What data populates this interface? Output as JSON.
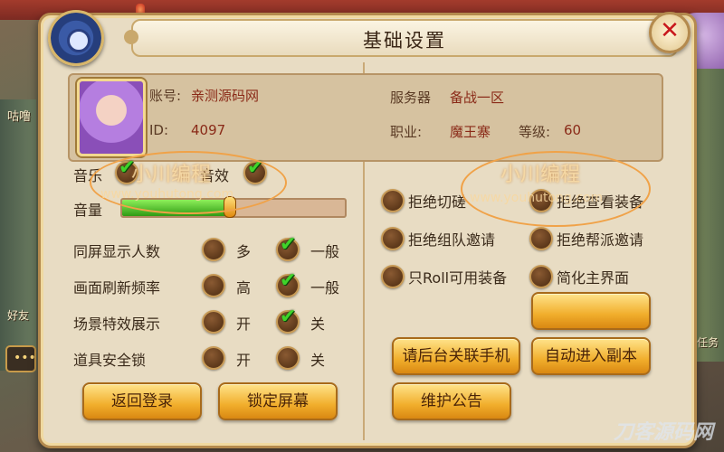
{
  "dialog": {
    "title": "基础设置"
  },
  "account": {
    "account_label": "账号:",
    "account_value": "亲测源码网",
    "id_label": "ID:",
    "id_value": "4097",
    "server_label": "服务器",
    "server_value": "备战一区",
    "job_label": "职业:",
    "job_value": "魔王寨",
    "level_label": "等级:",
    "level_value": "60"
  },
  "sound": {
    "music_label": "音乐",
    "music_checked": true,
    "sfx_label": "音效",
    "sfx_checked": true,
    "volume_label": "音量",
    "volume_fraction": 0.48
  },
  "options": [
    {
      "label": "同屏显示人数",
      "opt1": "多",
      "opt2": "一般",
      "selected": 2
    },
    {
      "label": "画面刷新频率",
      "opt1": "高",
      "opt2": "一般",
      "selected": 2
    },
    {
      "label": "场景特效展示",
      "opt1": "开",
      "opt2": "关",
      "selected": 2
    },
    {
      "label": "道具安全锁",
      "opt1": "开",
      "opt2": "关",
      "selected": 0
    }
  ],
  "toggles": [
    {
      "label": "拒绝切磋"
    },
    {
      "label": "拒绝查看装备"
    },
    {
      "label": "拒绝组队邀请"
    },
    {
      "label": "拒绝帮派邀请"
    },
    {
      "label": "只Roll可用装备"
    },
    {
      "label": "简化主界面"
    }
  ],
  "buttons": {
    "logout": "返回登录",
    "lock_screen": "锁定屏幕",
    "blank": "",
    "bind_phone": "请后台关联手机",
    "auto_dungeon": "自动进入副本",
    "notice": "维护公告"
  },
  "watermark": {
    "text1": "小川编程",
    "url1": "www.youhutong.com",
    "text2": "小川编程",
    "url2": "www.youhutong.com",
    "corner": "刀客源码网"
  },
  "background": {
    "left_text1": "咕噜",
    "left_text2": "好友",
    "right_text": "任务"
  },
  "colors": {
    "accent": "#f1ae2c",
    "check": "#3fd42a",
    "panel": "#e8dcc3"
  },
  "icons": {
    "settings": "gear-icon",
    "close": "close-icon",
    "chat": "chat-icon"
  }
}
